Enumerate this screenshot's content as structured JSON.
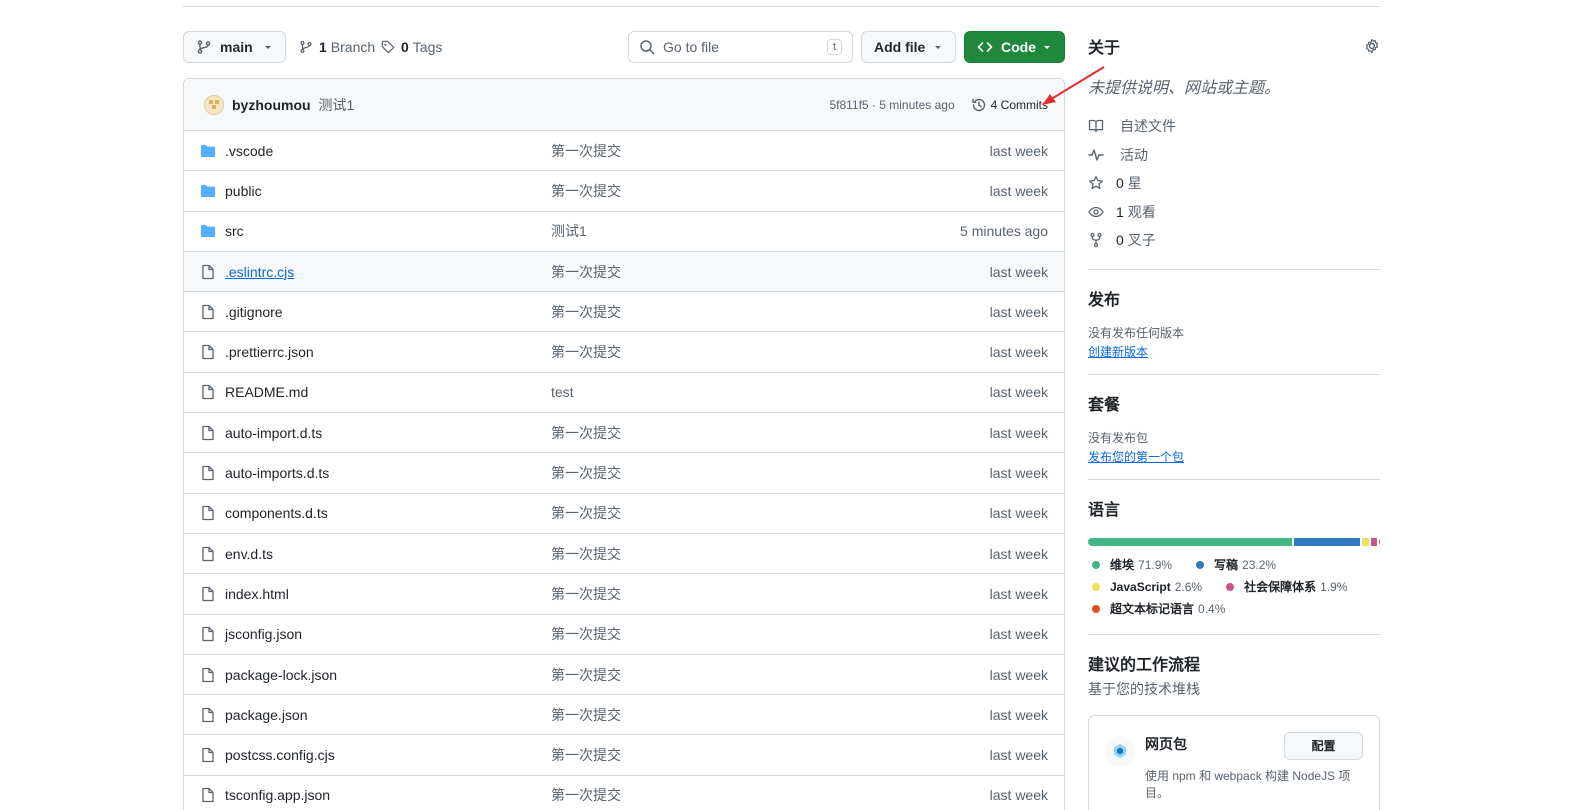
{
  "toolbar": {
    "branch_label": "main",
    "branches_count": "1",
    "branches_label": "Branch",
    "tags_count": "0",
    "tags_label": "Tags",
    "search_placeholder": "Go to file",
    "search_kbd": "t",
    "add_file_label": "Add file",
    "code_label": "Code"
  },
  "commit": {
    "author": "byzhoumou",
    "message": "测试1",
    "hash_time": "5f811f5 · 5 minutes ago",
    "commits_label": "4 Commits"
  },
  "files": [
    {
      "name": ".vscode",
      "type": "folder",
      "message": "第一次提交",
      "date": "last week"
    },
    {
      "name": "public",
      "type": "folder",
      "message": "第一次提交",
      "date": "last week"
    },
    {
      "name": "src",
      "type": "folder",
      "message": "测试1",
      "date": "5 minutes ago"
    },
    {
      "name": ".eslintrc.cjs",
      "type": "file",
      "message": "第一次提交",
      "date": "last week"
    },
    {
      "name": ".gitignore",
      "type": "file",
      "message": "第一次提交",
      "date": "last week"
    },
    {
      "name": ".prettierrc.json",
      "type": "file",
      "message": "第一次提交",
      "date": "last week"
    },
    {
      "name": "README.md",
      "type": "file",
      "message": "test",
      "date": "last week"
    },
    {
      "name": "auto-import.d.ts",
      "type": "file",
      "message": "第一次提交",
      "date": "last week"
    },
    {
      "name": "auto-imports.d.ts",
      "type": "file",
      "message": "第一次提交",
      "date": "last week"
    },
    {
      "name": "components.d.ts",
      "type": "file",
      "message": "第一次提交",
      "date": "last week"
    },
    {
      "name": "env.d.ts",
      "type": "file",
      "message": "第一次提交",
      "date": "last week"
    },
    {
      "name": "index.html",
      "type": "file",
      "message": "第一次提交",
      "date": "last week"
    },
    {
      "name": "jsconfig.json",
      "type": "file",
      "message": "第一次提交",
      "date": "last week"
    },
    {
      "name": "package-lock.json",
      "type": "file",
      "message": "第一次提交",
      "date": "last week"
    },
    {
      "name": "package.json",
      "type": "file",
      "message": "第一次提交",
      "date": "last week"
    },
    {
      "name": "postcss.config.cjs",
      "type": "file",
      "message": "第一次提交",
      "date": "last week"
    },
    {
      "name": "tsconfig.app.json",
      "type": "file",
      "message": "第一次提交",
      "date": "last week"
    }
  ],
  "sidebar": {
    "about_title": "关于",
    "about_desc": "未提供说明、网站或主题。",
    "stats": [
      {
        "icon": "book-icon",
        "count": "",
        "label": "自述文件"
      },
      {
        "icon": "pulse-icon",
        "count": "",
        "label": "活动"
      },
      {
        "icon": "star-icon",
        "count": "0",
        "label": "星"
      },
      {
        "icon": "eye-icon",
        "count": "1",
        "label": "观看"
      },
      {
        "icon": "fork-icon",
        "count": "0",
        "label": "叉子"
      }
    ],
    "releases_title": "发布",
    "releases_none": "没有发布任何版本",
    "releases_link": "创建新版本",
    "packages_title": "套餐",
    "packages_none": "没有发布包",
    "packages_link": "发布您的第一个包",
    "languages_title": "语言",
    "languages": [
      {
        "name": "维埃",
        "percent": "71.9%",
        "value": 71.9,
        "color": "#41b883"
      },
      {
        "name": "写稿",
        "percent": "23.2%",
        "value": 23.2,
        "color": "#3178c6"
      },
      {
        "name": "JavaScript",
        "percent": "2.6%",
        "value": 2.6,
        "color": "#f1e05a"
      },
      {
        "name": "社会保障体系",
        "percent": "1.9%",
        "value": 1.9,
        "color": "#c6538c"
      },
      {
        "name": "超文本标记语言",
        "percent": "0.4%",
        "value": 0.4,
        "color": "#e34c26"
      }
    ],
    "workflows_title": "建议的工作流程",
    "workflows_sub": "基于您的技术堆栈",
    "workflow": {
      "title": "网页包",
      "button": "配置",
      "desc": "使用 npm 和 webpack 构建 NodeJS 项目。"
    }
  }
}
